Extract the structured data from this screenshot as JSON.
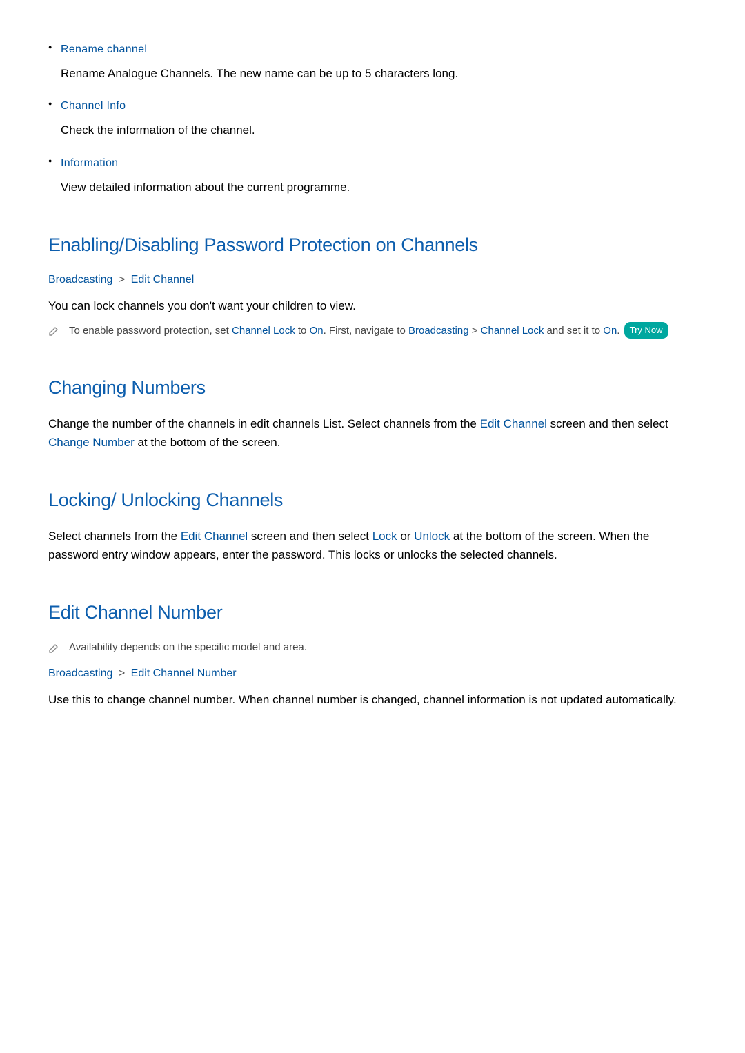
{
  "top_items": [
    {
      "title": "Rename channel",
      "desc": "Rename Analogue Channels. The new name can be up to 5 characters long."
    },
    {
      "title": "Channel Info",
      "desc": "Check the information of the channel."
    },
    {
      "title": "Information",
      "desc": "View detailed information about the current programme."
    }
  ],
  "section1": {
    "heading": "Enabling/Disabling Password Protection on Channels",
    "bc1": "Broadcasting",
    "sep": ">",
    "bc2": "Edit Channel",
    "body": "You can lock channels you don't want your children to view.",
    "note_pre": "To enable password protection, set ",
    "note_m1": "Channel Lock",
    "note_mid1": " to ",
    "note_m2": "On",
    "note_mid2": ". First, navigate to ",
    "note_m3": "Broadcasting",
    "note_sep": " > ",
    "note_m4": "Channel Lock",
    "note_mid3": " and set it to ",
    "note_m5": "On",
    "note_end": ". ",
    "try_now": "Try Now"
  },
  "section2": {
    "heading": "Changing Numbers",
    "body_pre": "Change the number of the channels in edit channels List. Select channels from the ",
    "body_m1": "Edit Channel",
    "body_mid1": " screen and then select ",
    "body_m2": "Change Number",
    "body_end": " at the bottom of the screen."
  },
  "section3": {
    "heading": "Locking/ Unlocking Channels",
    "body_pre": "Select channels from the ",
    "body_m1": "Edit Channel",
    "body_mid1": " screen and then select ",
    "body_m2": "Lock",
    "body_mid2": " or ",
    "body_m3": "Unlock",
    "body_end": " at the bottom of the screen. When the password entry window appears, enter the password. This locks or unlocks the selected channels."
  },
  "section4": {
    "heading": "Edit Channel Number",
    "note": "Availability depends on the specific model and area.",
    "bc1": "Broadcasting",
    "sep": ">",
    "bc2": "Edit Channel Number",
    "body": "Use this to change channel number. When channel number is changed, channel information is not updated automatically."
  }
}
